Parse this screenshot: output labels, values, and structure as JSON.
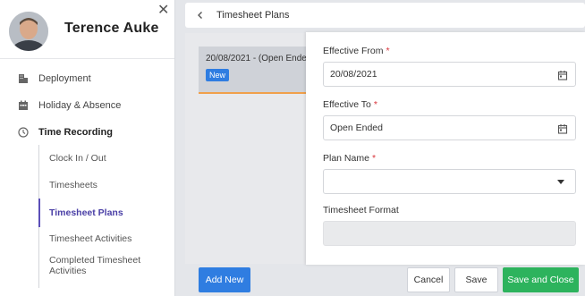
{
  "user": {
    "name": "Terence Auke"
  },
  "sidebar": {
    "items": [
      {
        "label": "Deployment",
        "icon": "building-icon"
      },
      {
        "label": "Holiday & Absence",
        "icon": "calendar-icon"
      },
      {
        "label": "Time Recording",
        "icon": "clock-icon"
      }
    ],
    "sub_items": [
      {
        "label": "Clock In / Out"
      },
      {
        "label": "Timesheets"
      },
      {
        "label": "Timesheet Plans",
        "active": true
      },
      {
        "label": "Timesheet Activities"
      },
      {
        "label": "Completed Timesheet Activities"
      }
    ]
  },
  "header": {
    "title": "Timesheet Plans"
  },
  "list": {
    "card_text": "20/08/2021 - (Open Ende",
    "badge": "New"
  },
  "form": {
    "effective_from": {
      "label": "Effective From",
      "required": "*",
      "value": "20/08/2021"
    },
    "effective_to": {
      "label": "Effective To",
      "required": "*",
      "value": "Open Ended"
    },
    "plan_name": {
      "label": "Plan Name",
      "required": "*",
      "value": ""
    },
    "timesheet_format": {
      "label": "Timesheet Format",
      "value": ""
    }
  },
  "buttons": {
    "add_new": "Add New",
    "cancel": "Cancel",
    "save": "Save",
    "save_and_close": "Save and Close"
  },
  "colors": {
    "primary_blue": "#2f7de1",
    "success_green": "#2db35d",
    "active_purple": "#5b4fb8",
    "accent_orange": "#f0a04b",
    "required_red": "#d9343b"
  }
}
